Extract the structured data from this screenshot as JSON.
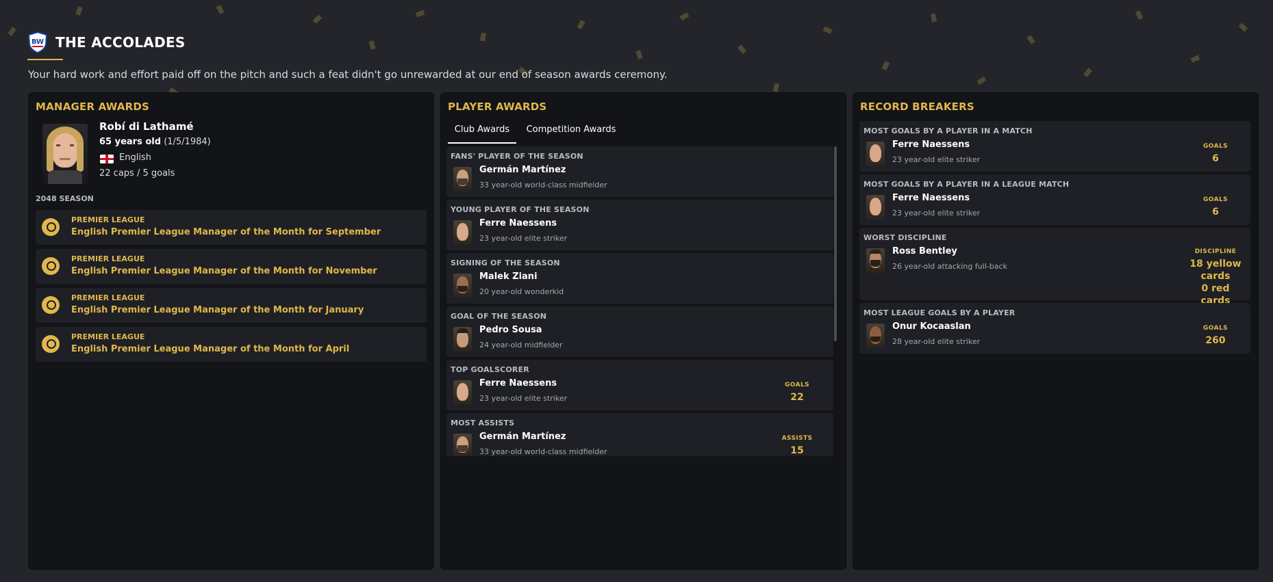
{
  "header": {
    "title": "THE ACCOLADES",
    "intro": "Your hard work and effort paid off on the pitch and such a feat didn't go unrewarded at our end of season awards ceremony."
  },
  "manager_awards": {
    "title": "MANAGER AWARDS",
    "manager": {
      "name": "Robí di Lathamé",
      "age_strong": "65 years old",
      "dob": "(1/5/1984)",
      "nationality": "English",
      "caps": "22 caps / 5 goals"
    },
    "season_label": "2048 SEASON",
    "awards": [
      {
        "competition": "PREMIER LEAGUE",
        "title": "English Premier League Manager of the Month for September"
      },
      {
        "competition": "PREMIER LEAGUE",
        "title": "English Premier League Manager of the Month for November"
      },
      {
        "competition": "PREMIER LEAGUE",
        "title": "English Premier League Manager of the Month for January"
      },
      {
        "competition": "PREMIER LEAGUE",
        "title": "English Premier League Manager of the Month for April"
      }
    ]
  },
  "player_awards": {
    "title": "PLAYER AWARDS",
    "tabs": [
      {
        "label": "Club Awards",
        "active": true
      },
      {
        "label": "Competition Awards",
        "active": false
      }
    ],
    "items": [
      {
        "category": "FANS' PLAYER OF THE SEASON",
        "name": "Germán Martínez",
        "desc": "33 year-old world-class midfielder"
      },
      {
        "category": "YOUNG PLAYER OF THE SEASON",
        "name": "Ferre Naessens",
        "desc": "23 year-old elite striker"
      },
      {
        "category": "SIGNING OF THE SEASON",
        "name": "Malek Ziani",
        "desc": "20 year-old wonderkid"
      },
      {
        "category": "GOAL OF THE SEASON",
        "name": "Pedro Sousa",
        "desc": "24 year-old midfielder"
      },
      {
        "category": "TOP GOALSCORER",
        "name": "Ferre Naessens",
        "desc": "23 year-old elite striker",
        "stat_label": "GOALS",
        "stat_value": "22"
      },
      {
        "category": "MOST ASSISTS",
        "name": "Germán Martínez",
        "desc": "33 year-old world-class midfielder",
        "stat_label": "ASSISTS",
        "stat_value": "15"
      }
    ]
  },
  "record_breakers": {
    "title": "RECORD BREAKERS",
    "items": [
      {
        "category": "MOST GOALS BY A PLAYER IN A MATCH",
        "name": "Ferre Naessens",
        "desc": "23 year-old elite striker",
        "stat_label": "GOALS",
        "stat_lines": [
          "6"
        ]
      },
      {
        "category": "MOST GOALS BY A PLAYER IN A LEAGUE MATCH",
        "name": "Ferre Naessens",
        "desc": "23 year-old elite striker",
        "stat_label": "GOALS",
        "stat_lines": [
          "6"
        ]
      },
      {
        "category": "WORST DISCIPLINE",
        "name": "Ross Bentley",
        "desc": "26 year-old attacking full-back",
        "stat_label": "DISCIPLINE",
        "stat_lines": [
          "18 yellow",
          "cards",
          "0 red cards"
        ]
      },
      {
        "category": "MOST LEAGUE GOALS BY A PLAYER",
        "name": "Onur Kocaaslan",
        "desc": "28 year-old elite striker",
        "stat_label": "GOALS",
        "stat_lines": [
          "260"
        ]
      }
    ]
  },
  "colors": {
    "accent": "#e1b74c",
    "background": "#23252b",
    "panel": "#131418",
    "card": "#1e2025"
  }
}
